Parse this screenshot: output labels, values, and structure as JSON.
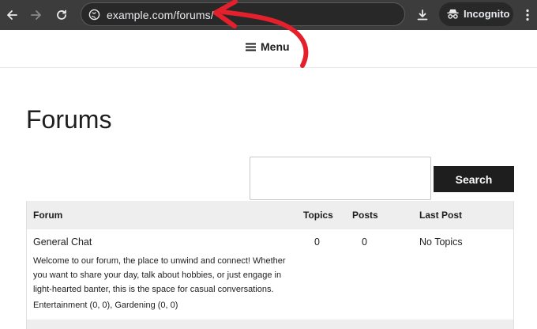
{
  "browser": {
    "url": "example.com/forums/",
    "incognito_label": "Incognito"
  },
  "header": {
    "menu_label": "Menu"
  },
  "page": {
    "title": "Forums"
  },
  "search": {
    "input_value": "",
    "button_label": "Search"
  },
  "table": {
    "columns": [
      "Forum",
      "Topics",
      "Posts",
      "Last Post"
    ],
    "rows": [
      {
        "name": "General Chat",
        "description": "Welcome to our forum, the place to unwind and connect! Whether you want to share your day, talk about hobbies, or just engage in light-hearted banter, this is the space for casual conversations.",
        "sub_forums": "Entertainment (0, 0), Gardening (0, 0)",
        "topics": "0",
        "posts": "0",
        "last_post": "No Topics"
      }
    ]
  },
  "colors": {
    "annotation_arrow": "#e3202c",
    "chrome_bg": "#3c3c3c",
    "button_bg": "#1e1e1e"
  },
  "icons": [
    "back-arrow-icon",
    "forward-arrow-icon",
    "reload-icon",
    "site-info-icon",
    "download-icon",
    "incognito-icon",
    "more-options-icon",
    "hamburger-icon"
  ]
}
